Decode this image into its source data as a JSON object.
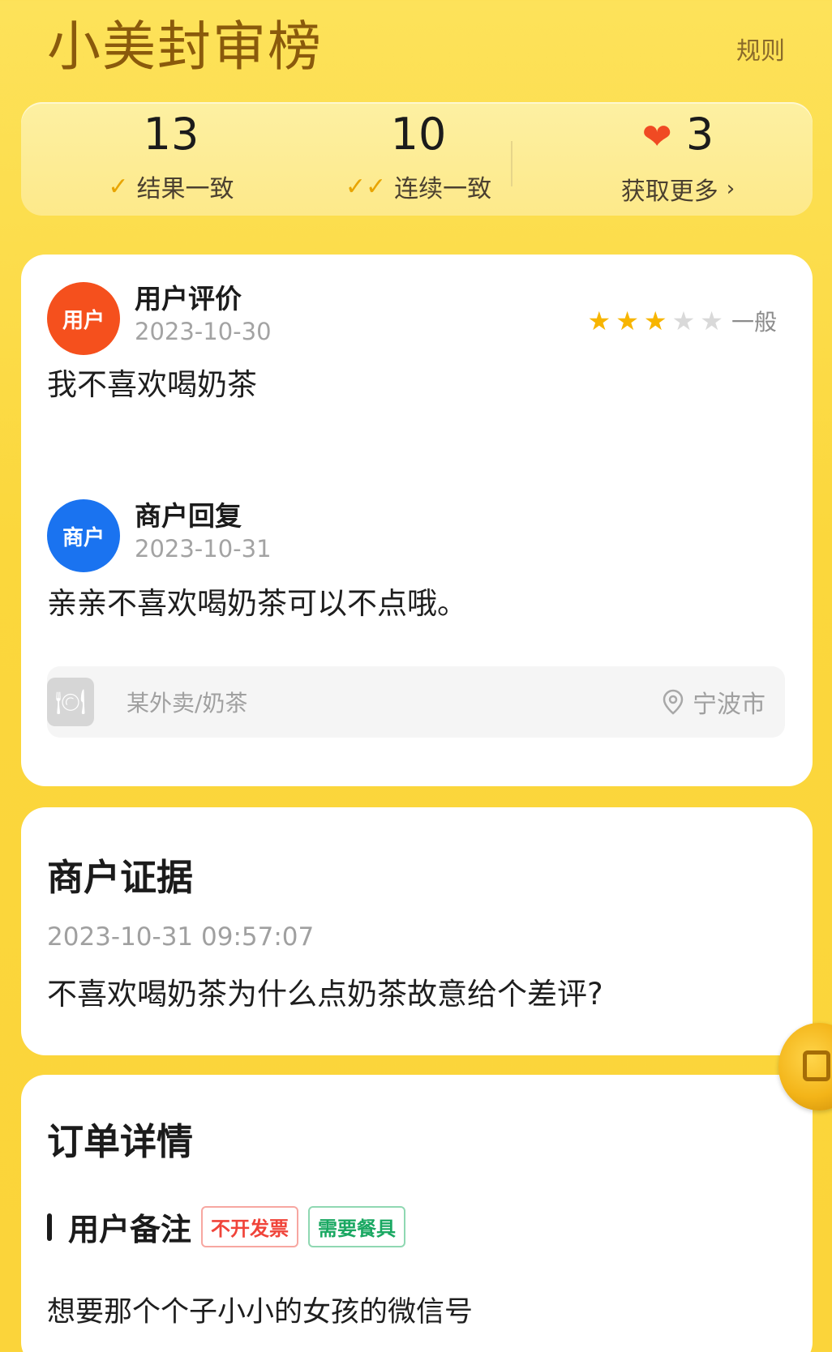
{
  "header": {
    "brand": "小美封审榜",
    "rules_label": "规则"
  },
  "stats": {
    "consistent_result": {
      "value": "13",
      "label": "结果一致"
    },
    "consecutive": {
      "value": "10",
      "label": "连续一致"
    },
    "hearts": {
      "value": "3",
      "label": "获取更多"
    }
  },
  "review": {
    "user": {
      "avatar_text": "用户",
      "title": "用户评价",
      "date": "2023-10-30",
      "rating": 3,
      "rating_max": 5,
      "rating_label": "一般",
      "text": "我不喜欢喝奶茶"
    },
    "merchant": {
      "avatar_text": "商户",
      "title": "商户回复",
      "date": "2023-10-31",
      "text": "亲亲不喜欢喝奶茶可以不点哦。"
    },
    "shop": {
      "name": "某外卖/奶茶",
      "city": "宁波市"
    }
  },
  "evidence": {
    "title": "商户证据",
    "timestamp": "2023-10-31 09:57:07",
    "text": "不喜欢喝奶茶为什么点奶茶故意给个差评?"
  },
  "order": {
    "title": "订单详情",
    "note_title": "用户备注",
    "tags": [
      "不开发票",
      "需要餐具"
    ],
    "note_text": "想要那个个子小小的女孩的微信号"
  },
  "colors": {
    "accent_yellow": "#fbd73c",
    "user_avatar": "#f5501d",
    "merchant_avatar": "#1a73f0",
    "heart": "#f04a23",
    "star": "#f7b500"
  }
}
